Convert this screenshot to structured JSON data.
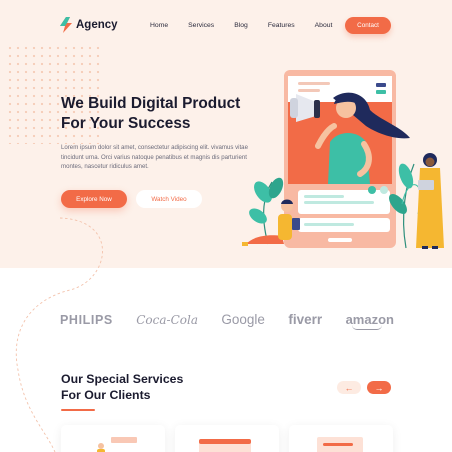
{
  "brand": {
    "name": "Agency"
  },
  "nav": {
    "items": [
      "Home",
      "Services",
      "Blog",
      "Features",
      "About"
    ],
    "contact_label": "Contact"
  },
  "hero": {
    "title_line1": "We Build Digital Product",
    "title_line2": "For Your Success",
    "description": "Lorem ipsum dolor sit amet, consectetur adipiscing elit. vivamus vitae tincidunt urna. Orci varius natoque penatibus et magnis dis parturient montes, nascetur ridiculus amet.",
    "primary_cta": "Explore Now",
    "secondary_cta": "Watch Video"
  },
  "clients": {
    "logos": [
      "PHILIPS",
      "Coca-Cola",
      "Google",
      "fiverr",
      "amazon"
    ]
  },
  "services": {
    "title_line1": "Our Special Services",
    "title_line2": "For Our Clients",
    "prev_icon": "arrow-left-icon",
    "next_icon": "arrow-right-icon"
  },
  "colors": {
    "accent": "#f26b47",
    "hero_bg": "#fdf1ea",
    "teal": "#3dbfa6",
    "navy": "#1b1b2f"
  }
}
